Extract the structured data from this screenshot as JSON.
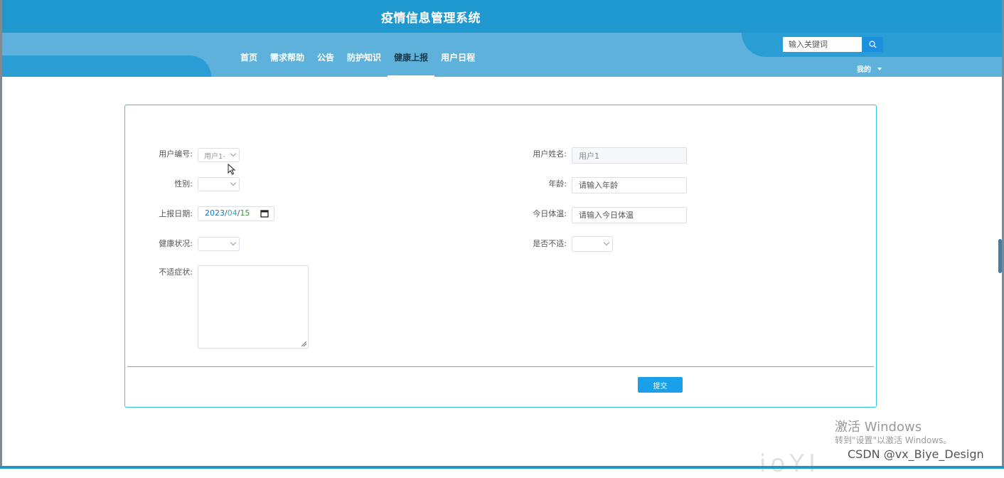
{
  "app": {
    "title": "疫情信息管理系统"
  },
  "nav": {
    "items": [
      {
        "label": "首页"
      },
      {
        "label": "需求帮助"
      },
      {
        "label": "公告"
      },
      {
        "label": "防护知识"
      },
      {
        "label": "健康上报",
        "active": true
      },
      {
        "label": "用户日程"
      }
    ]
  },
  "search": {
    "placeholder": "输入关键词",
    "icon": "search-icon"
  },
  "user_menu": {
    "label": "我的"
  },
  "form": {
    "user_no": {
      "label": "用户编号:",
      "value": "用户1"
    },
    "user_name": {
      "label": "用户姓名:",
      "value": "用户1"
    },
    "gender": {
      "label": "性别:",
      "value": ""
    },
    "age": {
      "label": "年龄:",
      "placeholder": "请输入年龄"
    },
    "report_date": {
      "label": "上报日期:",
      "year": "2023",
      "month": "04",
      "day": "15",
      "sep": "/"
    },
    "temperature": {
      "label": "今日体温:",
      "placeholder": "请输入今日体温"
    },
    "health": {
      "label": "健康状况:",
      "value": ""
    },
    "unwell": {
      "label": "是否不适:",
      "value": ""
    },
    "symptoms": {
      "label": "不适症状:",
      "value": ""
    },
    "submit_label": "提交"
  },
  "overlay": {
    "activate_title": "激活 Windows",
    "activate_sub": "转到\"设置\"以激活 Windows。",
    "watermark": "CSDN @vx_Biye_Design"
  },
  "colors": {
    "header": "#1e98ce",
    "band": "#5eb1db",
    "accent": "#33c5e8",
    "button": "#1aa0e8"
  }
}
